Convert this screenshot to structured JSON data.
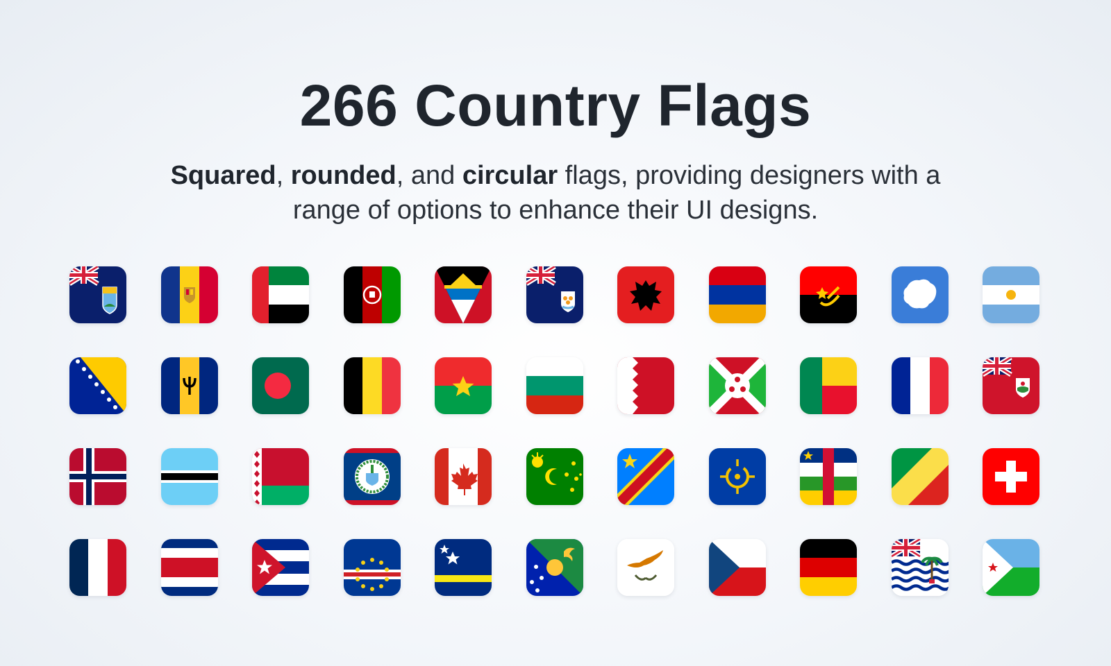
{
  "hero": {
    "title": "266 Country Flags",
    "sub_b1": "Squared",
    "sub_t1": ", ",
    "sub_b2": "rounded",
    "sub_t2": ", and ",
    "sub_b3": "circular",
    "sub_t3": " flags, providing designers with a range of options to enhance their UI designs."
  },
  "colors": {
    "text": "#1f252d",
    "background": "#eef2f7"
  },
  "flags": [
    "saint-helena-flag-icon",
    "andorra-flag-icon",
    "uae-flag-icon",
    "afghanistan-flag-icon",
    "antigua-flag-icon",
    "anguilla-flag-icon",
    "albania-flag-icon",
    "armenia-flag-icon",
    "angola-flag-icon",
    "antarctica-flag-icon",
    "argentina-flag-icon",
    "bosnia-flag-icon",
    "barbados-flag-icon",
    "bangladesh-flag-icon",
    "belgium-flag-icon",
    "burkina-faso-flag-icon",
    "bulgaria-flag-icon",
    "bahrain-flag-icon",
    "burundi-flag-icon",
    "benin-flag-icon",
    "saint-barthelemy-flag-icon",
    "bermuda-flag-icon",
    "bouvet-island-flag-icon",
    "botswana-flag-icon",
    "belarus-flag-icon",
    "belize-flag-icon",
    "canada-flag-icon",
    "cocos-islands-flag-icon",
    "dr-congo-flag-icon",
    "ceeac-flag-icon",
    "central-african-republic-flag-icon",
    "congo-flag-icon",
    "switzerland-flag-icon",
    "clipperton-flag-icon",
    "costa-rica-flag-icon",
    "cuba-flag-icon",
    "cape-verde-flag-icon",
    "curacao-flag-icon",
    "christmas-island-flag-icon",
    "cyprus-flag-icon",
    "czechia-flag-icon",
    "germany-flag-icon",
    "biot-flag-icon",
    "djibouti-flag-icon"
  ]
}
